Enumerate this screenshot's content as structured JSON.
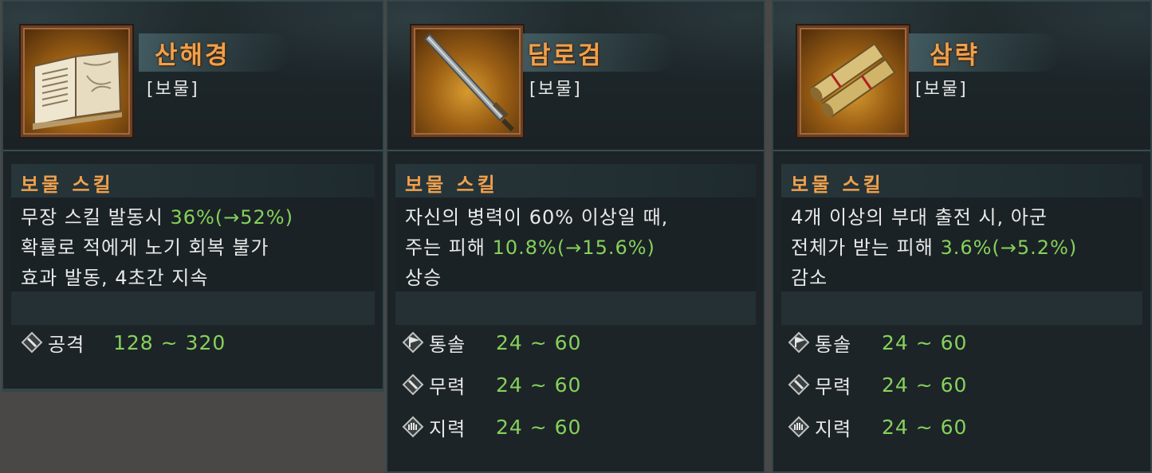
{
  "colors": {
    "accent_orange": "#f0a04c",
    "value_green": "#86d15a",
    "panel_bg": "#1c2428"
  },
  "cards": [
    {
      "name": "산해경",
      "category": "[보물]",
      "icon": "book-icon",
      "skill_title": "보물 스킬",
      "desc": {
        "l1_pre": "무장 스킬 발동시 ",
        "l1_val": "36%(→52%)",
        "l1_post": "",
        "l2_pre": "확률로 적에게 노기 회복 불가",
        "l2_val": "",
        "l2_post": "",
        "l3": "효과 발동, 4초간 지속"
      },
      "stats": [
        {
          "icon": "sword-stat-icon",
          "label": "공격",
          "value": "128 ~ 320"
        }
      ]
    },
    {
      "name": "담로검",
      "category": "[보물]",
      "icon": "sword-icon",
      "skill_title": "보물 스킬",
      "desc": {
        "l1_pre": "자신의 병력이 60% 이상일 때,",
        "l1_val": "",
        "l1_post": "",
        "l2_pre": "주는 피해 ",
        "l2_val": "10.8%(→15.6%)",
        "l2_post": "",
        "l3": "상승"
      },
      "stats": [
        {
          "icon": "flag-stat-icon",
          "label": "통솔",
          "value": "24 ~ 60"
        },
        {
          "icon": "sword-stat-icon",
          "label": "무력",
          "value": "24 ~ 60"
        },
        {
          "icon": "hand-stat-icon",
          "label": "지력",
          "value": "24 ~ 60"
        }
      ]
    },
    {
      "name": "삼략",
      "category": "[보물]",
      "icon": "scroll-icon",
      "skill_title": "보물 스킬",
      "desc": {
        "l1_pre": "4개 이상의 부대 출전 시, 아군",
        "l1_val": "",
        "l1_post": "",
        "l2_pre": "전체가 받는 피해 ",
        "l2_val": "3.6%(→5.2%)",
        "l2_post": "",
        "l3": "감소"
      },
      "stats": [
        {
          "icon": "flag-stat-icon",
          "label": "통솔",
          "value": "24 ~ 60"
        },
        {
          "icon": "sword-stat-icon",
          "label": "무력",
          "value": "24 ~ 60"
        },
        {
          "icon": "hand-stat-icon",
          "label": "지력",
          "value": "24 ~ 60"
        }
      ]
    }
  ]
}
